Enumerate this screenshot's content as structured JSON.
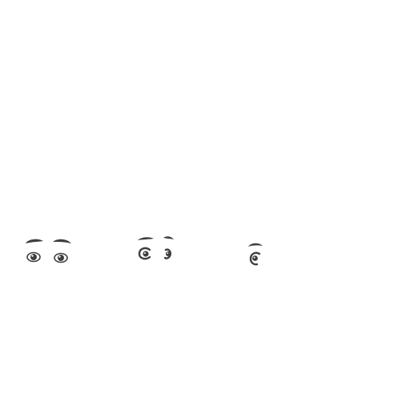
{
  "colors": {
    "background": "#ffffff",
    "ink": "#3f3f3f",
    "eye_white": "#ffffff"
  },
  "eye_sets": [
    {
      "view": "front",
      "icon": "eyes-front-icon"
    },
    {
      "view": "three-quarter",
      "icon": "eyes-three-quarter-icon"
    },
    {
      "view": "profile",
      "icon": "eye-profile-icon"
    }
  ]
}
